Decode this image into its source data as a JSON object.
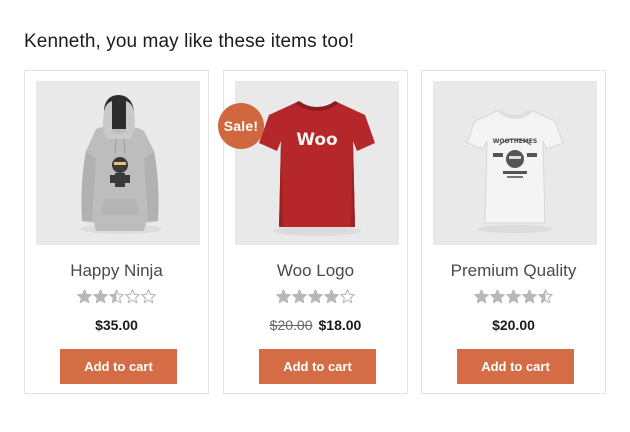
{
  "heading": "Kenneth, you may like these items too!",
  "colors": {
    "accent": "#d46c46",
    "sale_badge": "#d0673f",
    "star": "#b8b8b8",
    "card_border": "#e3e3e3"
  },
  "products": [
    {
      "title": "Happy Ninja",
      "rating": 2.5,
      "rating_max": 5,
      "price": "$35.00",
      "old_price": "",
      "sale_label": "",
      "button": "Add to cart",
      "image_icon": "hoodie-image"
    },
    {
      "title": "Woo Logo",
      "rating": 4,
      "rating_max": 5,
      "price": "$18.00",
      "old_price": "$20.00",
      "sale_label": "Sale!",
      "shirt_text": "Woo",
      "button": "Add to cart",
      "image_icon": "red-tshirt-image"
    },
    {
      "title": "Premium Quality",
      "rating": 4.5,
      "rating_max": 5,
      "price": "$20.00",
      "old_price": "",
      "sale_label": "",
      "shirt_text_top": "WOOTHEMES",
      "button": "Add to cart",
      "image_icon": "white-tshirt-image"
    }
  ]
}
